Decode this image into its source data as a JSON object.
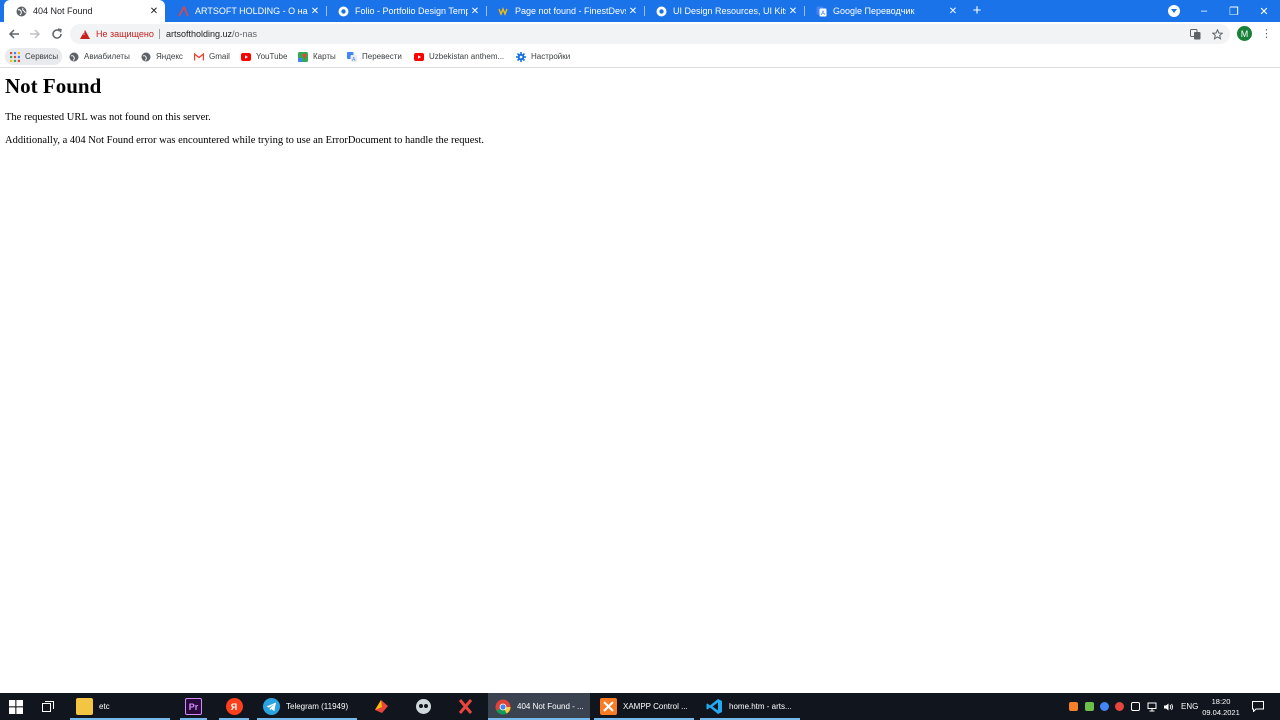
{
  "browser": {
    "tabs": [
      {
        "title": "404 Not Found",
        "active": true
      },
      {
        "title": "ARTSOFT HOLDING - О нас",
        "active": false
      },
      {
        "title": "Folio - Portfolio Design Template",
        "active": false
      },
      {
        "title": "Page not found - FinestDevs",
        "active": false
      },
      {
        "title": "UI Design Resources, UI Kits, Wireframes",
        "active": false
      },
      {
        "title": "Google Переводчик",
        "active": false
      }
    ],
    "new_tab_symbol": "+",
    "close_symbol": "✕",
    "window_controls": {
      "minimize": "–",
      "maximize": "❐",
      "close": "✕"
    },
    "accent_color": "#1a73e8"
  },
  "toolbar": {
    "security_label": "Не защищено",
    "url_host": "artsoftholding.uz",
    "url_path": "/o-nas",
    "profile_initial": "M",
    "profile_color": "#188038"
  },
  "bookmarks": {
    "items": [
      {
        "label": "Сервисы",
        "icon": "apps-grid-icon"
      },
      {
        "label": "Авиабилеты",
        "icon": "globe-icon"
      },
      {
        "label": "Яндекс",
        "icon": "globe-icon"
      },
      {
        "label": "Gmail",
        "icon": "gmail-icon"
      },
      {
        "label": "YouTube",
        "icon": "youtube-icon"
      },
      {
        "label": "Карты",
        "icon": "maps-icon"
      },
      {
        "label": "Перевести",
        "icon": "translate-icon"
      },
      {
        "label": "Uzbekistan anthem...",
        "icon": "youtube-icon"
      },
      {
        "label": "Настройки",
        "icon": "gear-icon"
      }
    ]
  },
  "page": {
    "heading": "Not Found",
    "message": "The requested URL was not found on this server.",
    "detail": "Additionally, a 404 Not Found error was encountered while trying to use an ErrorDocument to handle the request."
  },
  "taskbar": {
    "apps": [
      {
        "label": "etc",
        "icon": "folder-icon"
      },
      {
        "label": "",
        "icon": "premiere-icon",
        "glyph": "Pr"
      },
      {
        "label": "",
        "icon": "yandex-browser-icon",
        "glyph": "Я"
      },
      {
        "label": "Telegram (11949)",
        "icon": "telegram-icon"
      },
      {
        "label": "404 Not Found - ...",
        "icon": "chrome-icon"
      },
      {
        "label": "XAMPP Control ...",
        "icon": "xampp-icon"
      },
      {
        "label": "home.htm - arts...",
        "icon": "vscode-icon"
      }
    ],
    "language": "ENG",
    "time": "18:20",
    "date": "09.04.2021"
  }
}
